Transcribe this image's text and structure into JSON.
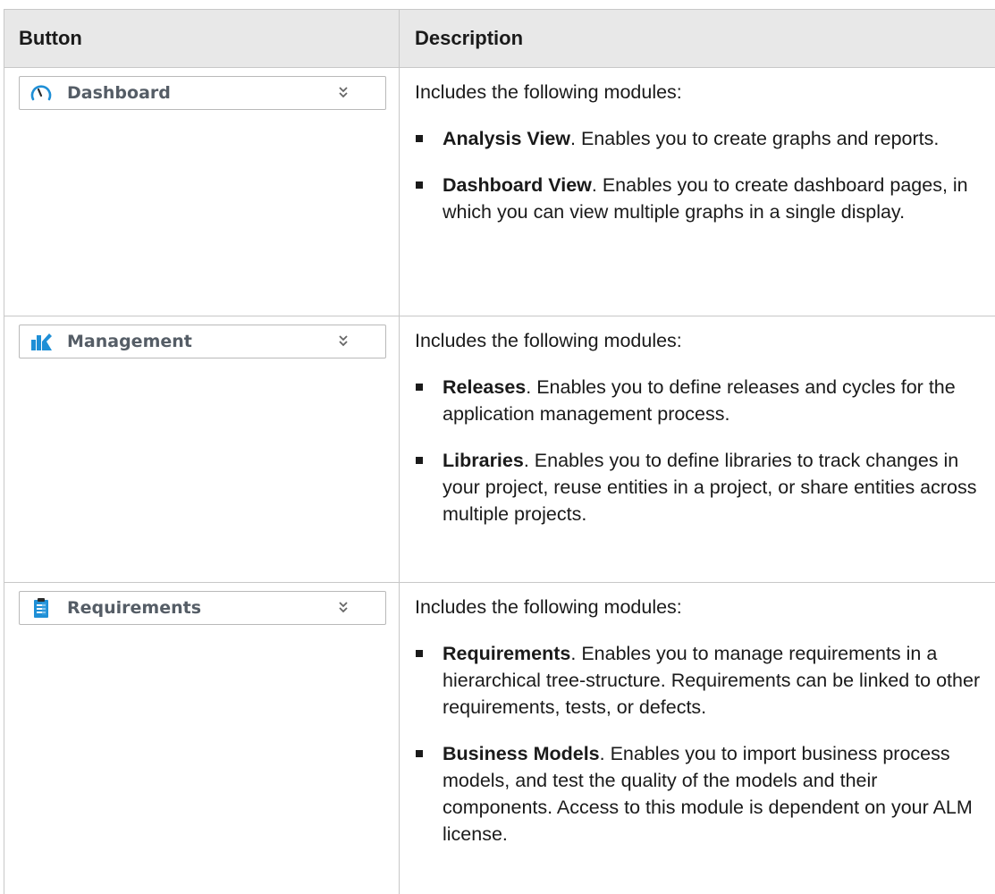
{
  "table": {
    "headers": {
      "button": "Button",
      "description": "Description"
    },
    "rows": [
      {
        "button_label": "Dashboard",
        "icon": "speedometer-icon",
        "intro": "Includes the following modules:",
        "items": [
          {
            "name": "Analysis View",
            "text": ". Enables you to create graphs and reports."
          },
          {
            "name": "Dashboard View",
            "text": ". Enables you to create dashboard pages, in which you can view multiple graphs in a single display."
          }
        ]
      },
      {
        "button_label": "Management",
        "icon": "bar-chart-icon",
        "intro": "Includes the following modules:",
        "items": [
          {
            "name": "Releases",
            "text": ". Enables you to define releases and cycles for the application management process."
          },
          {
            "name": "Libraries",
            "text": ". Enables you to define libraries to track changes in your project, reuse entities in a project, or share entities across multiple projects."
          }
        ]
      },
      {
        "button_label": "Requirements",
        "icon": "clipboard-icon",
        "intro": "Includes the following modules:",
        "items": [
          {
            "name": "Requirements",
            "text": ". Enables you to manage requirements in a hierarchical tree-structure. Requirements can be linked to other requirements, tests, or defects."
          },
          {
            "name": "Business Models",
            "text": ". Enables you to import business process models, and test the quality of the models and their components. Access to this module is dependent on your ALM license."
          }
        ]
      }
    ]
  },
  "colors": {
    "header_bg": "#e8e8e8",
    "border": "#c8c8c8",
    "button_text": "#555d66",
    "icon_blue": "#1f8fd6"
  }
}
